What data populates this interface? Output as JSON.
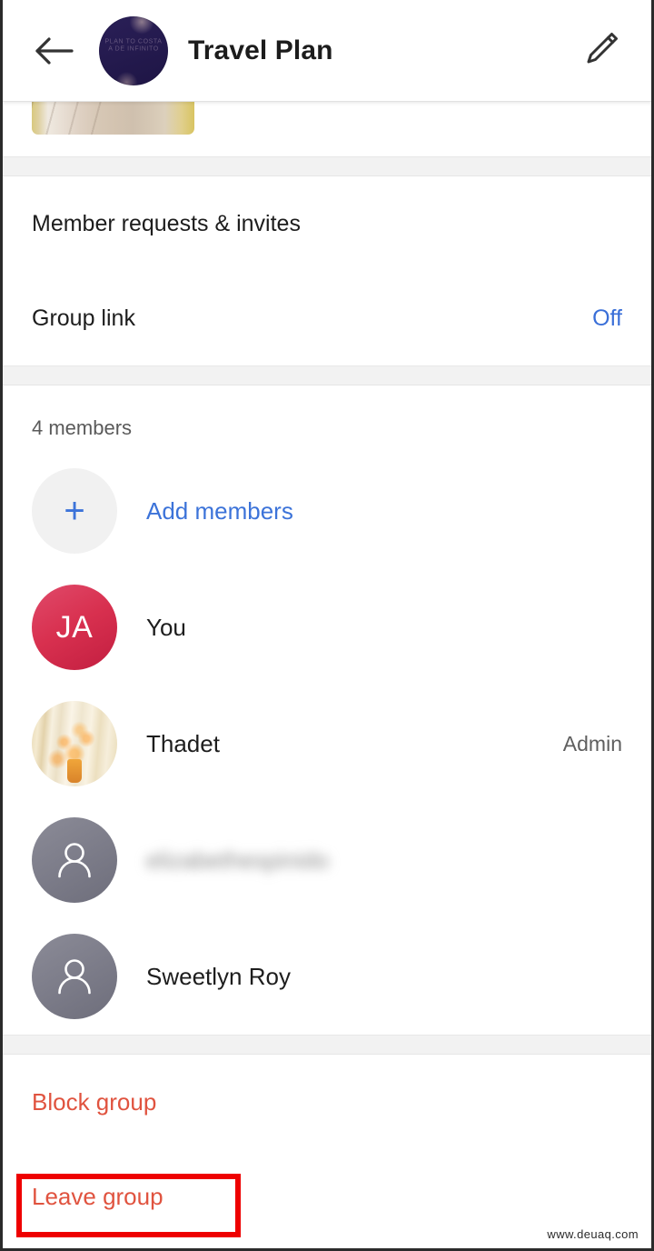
{
  "header": {
    "back_icon": "back-arrow-icon",
    "avatar_text": "PLAN TO COSTA\nA DE INFINITO",
    "title": "Travel Plan",
    "edit_icon": "pencil-icon"
  },
  "media_strip": {
    "thumbnail_alt": "photo-thumbnail"
  },
  "settings": {
    "rows": [
      {
        "label": "Member requests & invites",
        "value": ""
      },
      {
        "label": "Group link",
        "value": "Off"
      }
    ]
  },
  "members": {
    "count_label": "4 members",
    "add": {
      "label": "Add members",
      "icon": "plus-icon"
    },
    "list": [
      {
        "name": "You",
        "initials": "JA",
        "avatar": "initials",
        "role": ""
      },
      {
        "name": "Thadet",
        "initials": "",
        "avatar": "photo",
        "role": "Admin"
      },
      {
        "name": "elizabethespinido",
        "initials": "",
        "avatar": "generic",
        "role": "",
        "blurred": true
      },
      {
        "name": "Sweetlyn Roy",
        "initials": "",
        "avatar": "generic",
        "role": ""
      }
    ]
  },
  "danger": {
    "block_group": "Block group",
    "leave_group": "Leave group"
  },
  "annotation": {
    "highlight_target": "leave-group-row",
    "color": "#ee0000"
  },
  "watermark": {
    "text": "www.deuaq.com"
  },
  "colors": {
    "accent_blue": "#3a6fd8",
    "danger_red": "#e0533f",
    "annotation_red": "#ee0000",
    "initials_avatar": "#d8304f",
    "generic_avatar": "#7b7b88",
    "separator": "#f2f2f2"
  }
}
